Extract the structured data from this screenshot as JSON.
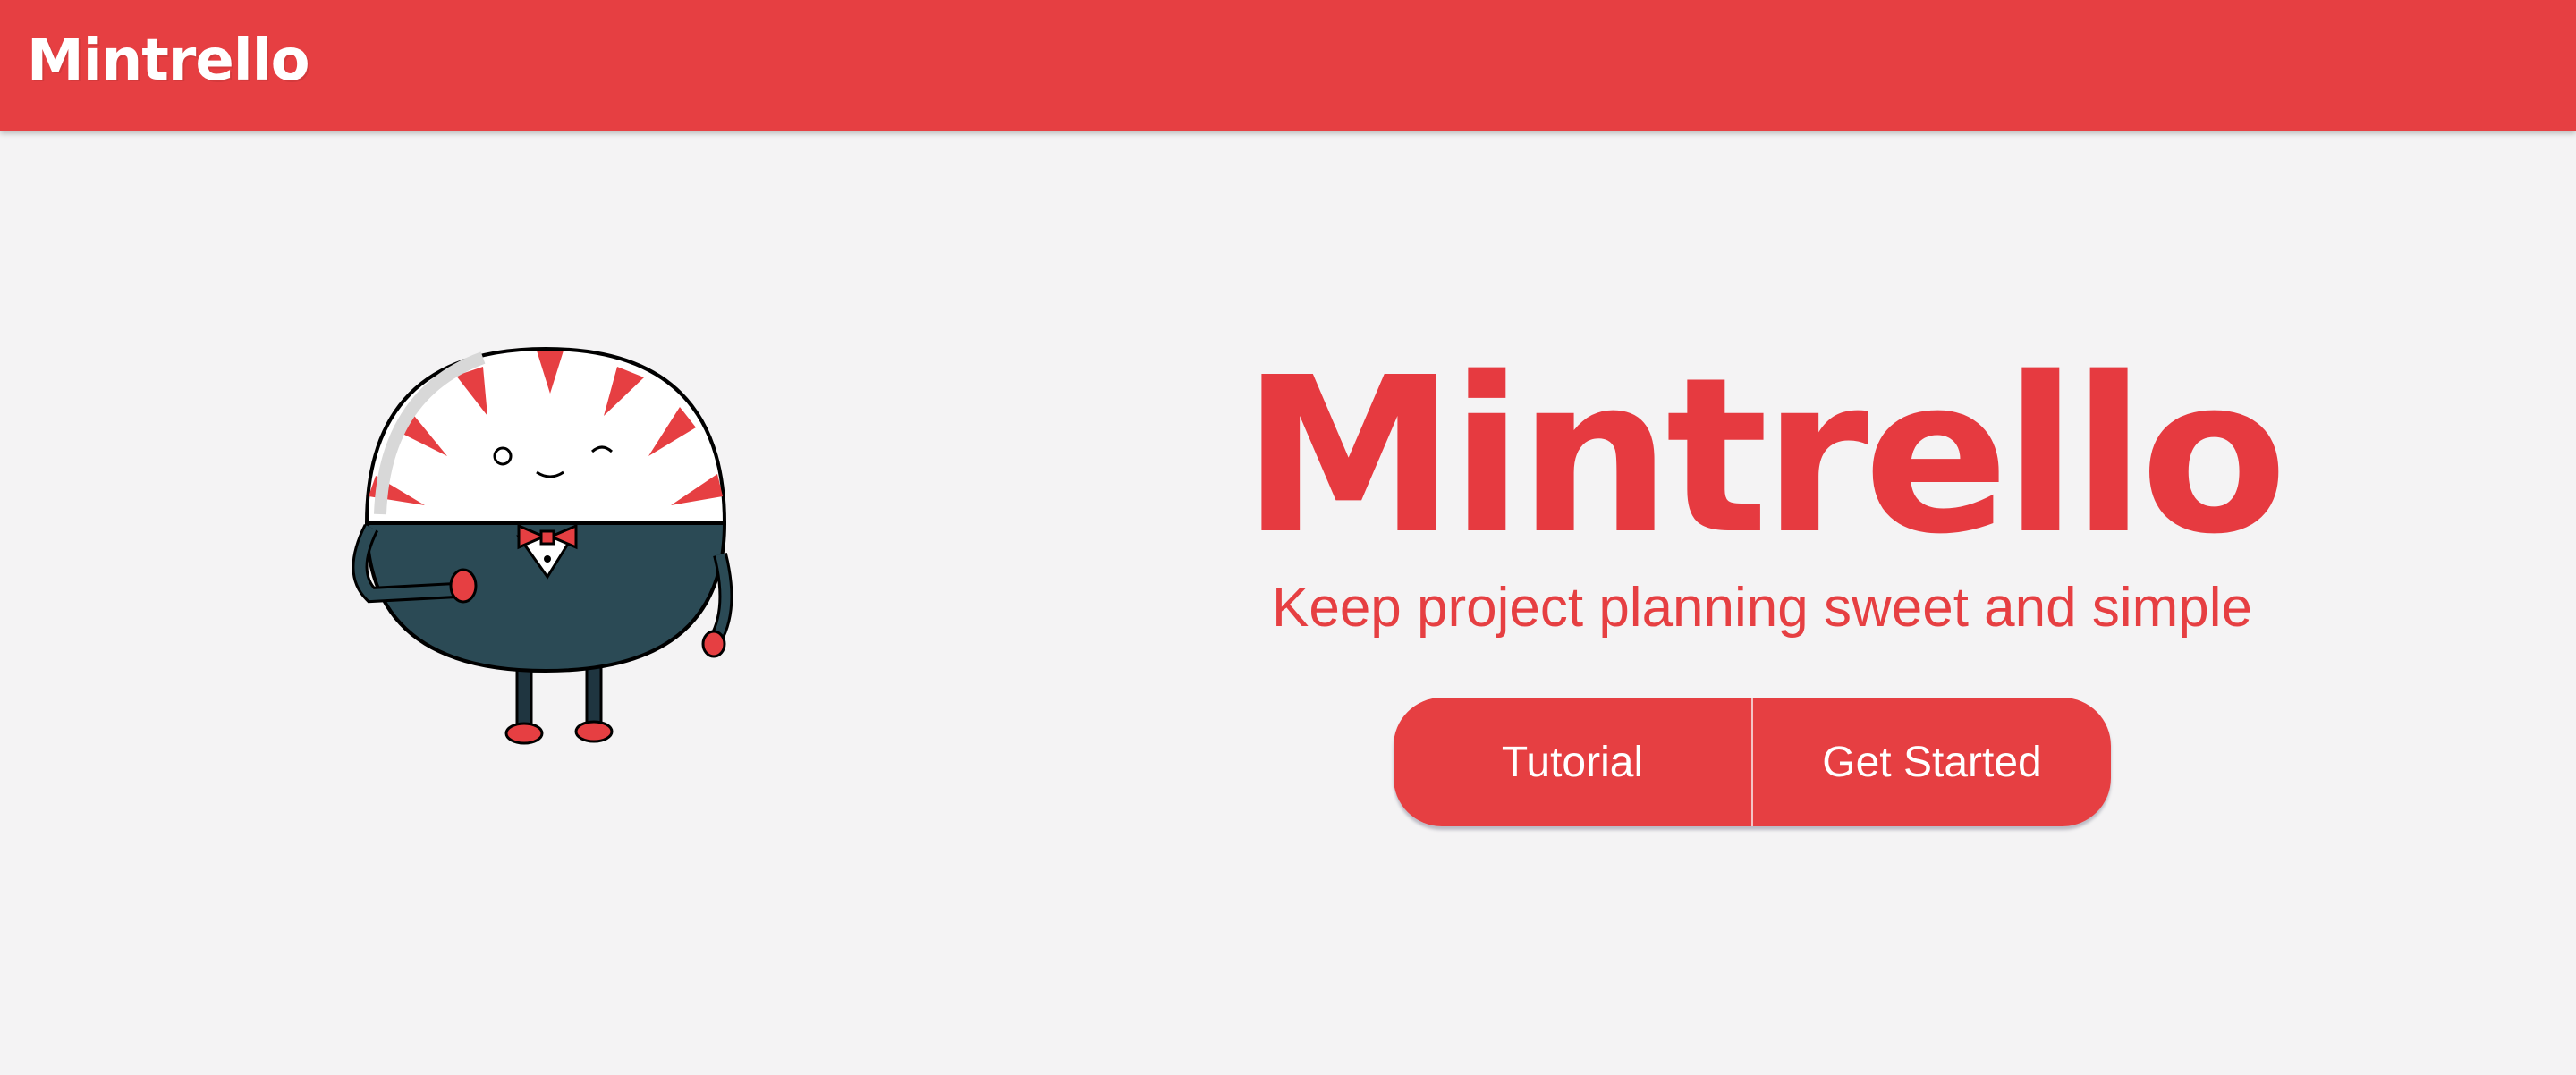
{
  "navbar": {
    "logo": "Mintrello"
  },
  "hero": {
    "title": "Mintrello",
    "subtitle": "Keep project planning sweet and simple",
    "buttons": {
      "tutorial": "Tutorial",
      "get_started": "Get Started"
    }
  },
  "mascot": {
    "icon": "peppermint-butler-icon"
  },
  "colors": {
    "brand_red": "#e63f42",
    "background": "#f4f3f4",
    "mascot_dark": "#2b4a55"
  }
}
